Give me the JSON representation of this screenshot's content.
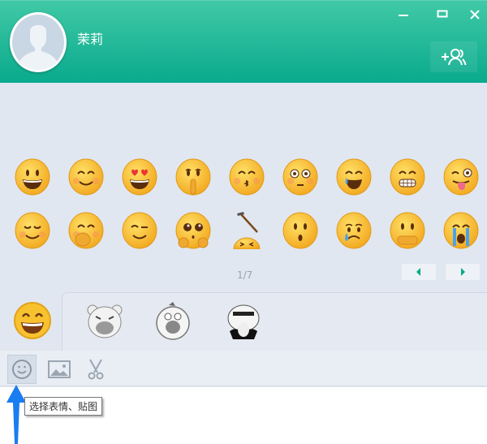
{
  "header": {
    "contact_name": "茉莉",
    "controls": {
      "minimize": "minimize-icon",
      "maximize": "maximize-icon",
      "close": "close-icon"
    },
    "add_member_icon": "add-group-member-icon"
  },
  "emoji_panel": {
    "rows": [
      [
        "grinning",
        "smile-blush",
        "heart-eyes",
        "shush",
        "kissing",
        "flushed",
        "laugh-tears",
        "grimace",
        "wink-tongue"
      ],
      [
        "relieved",
        "giggle-hand",
        "wink",
        "pleading",
        "hammer-hit",
        "surprised",
        "crying-tear",
        "covering-mouth",
        "sobbing"
      ]
    ],
    "page_indicator": "1/7",
    "prev_icon": "arrow-left-icon",
    "next_icon": "arrow-right-icon"
  },
  "tabs": [
    "emoji",
    "bear-sticker",
    "chicken-sticker",
    "cat-sticker"
  ],
  "toolbar": {
    "items": [
      "emoji-icon",
      "image-icon",
      "scissors-icon"
    ]
  },
  "tooltip": {
    "text": "选择表情、贴图"
  },
  "colors": {
    "header_top": "#40c9a6",
    "header_bottom": "#09aa8d",
    "accent": "#0aa986",
    "arrow": "#1a7df0"
  }
}
